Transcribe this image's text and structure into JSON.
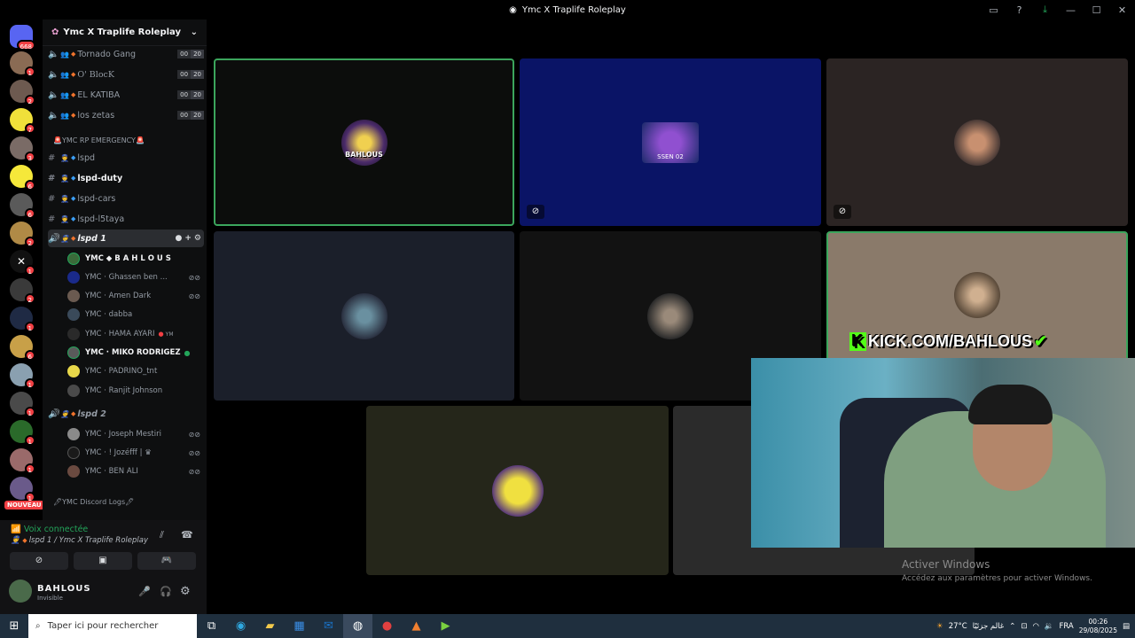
{
  "window": {
    "title": "Ymc X Traplife Roleplay"
  },
  "server_rail": {
    "home_badge": "668",
    "badges": [
      "1",
      "2",
      "7",
      "3",
      "6",
      "6",
      "2",
      "1",
      "2",
      "1",
      "6",
      "1",
      "1",
      "1",
      "1",
      "1"
    ],
    "new_label": "NOUVEAU"
  },
  "sidebar": {
    "guild_name": "Ymc X Traplife Roleplay",
    "gang_channels": [
      {
        "name": "Tornado Gang",
        "a": "00",
        "b": "20"
      },
      {
        "name": "O' BlocK",
        "a": "00",
        "b": "20"
      },
      {
        "name": "EL KATIBA",
        "a": "00",
        "b": "20"
      },
      {
        "name": "los zetas",
        "a": "00",
        "b": "20"
      }
    ],
    "category_emergency": "🚨YMC RP EMERGENCY🚨",
    "text_channels": [
      "lspd",
      "lspd-duty",
      "lspd-cars",
      "lspd-l5taya"
    ],
    "voice_lspd1": "lspd 1",
    "lspd1_users": [
      "YMC ◆ B A H L O U S",
      "YMC · Ghassen ben ...",
      "YMC · Amen Dark",
      "YMC · dabba",
      "YMC · HAMA AYARI",
      "YMC · MIKO RODRIGEZ",
      "YMC · PADRINO_tnt",
      "YMC · Ranjit Johnson"
    ],
    "hama_suffix": "YM",
    "voice_lspd2": "lspd 2",
    "lspd2_users": [
      "YMC · Joseph Mestiri",
      "YMC · ! Jozéfff | ♛",
      "YMC · BEN ALI"
    ],
    "category_logs": "🖊YMC Discord Logs🖊"
  },
  "voice_panel": {
    "status": "Voix connectée",
    "location": "lspd 1 / Ymc X Traplife Roleplay",
    "user_name": "BAHLOUS",
    "user_status": "Invisible"
  },
  "stream": {
    "overlay_text": "KICK.COM/BAHLOUS",
    "tile_3_label": "SSEN 02",
    "tile_1_label": "BAHLOUS"
  },
  "watermark": {
    "line1": "Activer Windows",
    "line2": "Accédez aux paramètres pour activer Windows."
  },
  "taskbar": {
    "search_placeholder": "Taper ici pour rechercher",
    "weather": "27°C",
    "weather_text": "غالم جزئيًا",
    "lang": "FRA",
    "time": "00:26",
    "date": "29/08/2025"
  }
}
